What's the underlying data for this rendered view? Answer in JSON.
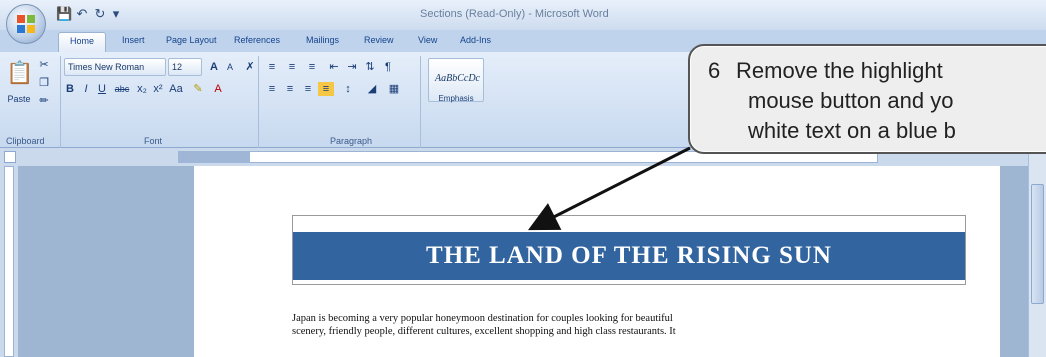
{
  "window": {
    "title": "Sections (Read-Only) - Microsoft Word"
  },
  "tabs": [
    "Home",
    "Insert",
    "Page Layout",
    "References",
    "Mailings",
    "Review",
    "View",
    "Add-Ins"
  ],
  "ribbon": {
    "clipboard": {
      "paste_label": "Paste",
      "group_label": "Clipboard"
    },
    "font": {
      "font_name": "Times New Roman",
      "font_size": "12",
      "group_label": "Font"
    },
    "paragraph": {
      "group_label": "Paragraph"
    },
    "styles": {
      "preview_text": "AaBbCcDc",
      "emphasis_label": "Emphasis"
    }
  },
  "document": {
    "banner_title": "THE LAND OF THE RISING SUN",
    "body_lines": [
      "Japan is becoming a very popular honeymoon destination for couples looking for beautiful",
      "scenery, friendly people, different cultures, excellent shopping and high class restaurants. It"
    ]
  },
  "callout": {
    "number": "6",
    "lines": [
      "Remove the highlight",
      "mouse button and yo",
      "white text on a blue b"
    ]
  },
  "colors": {
    "banner_bg": "#3264a0",
    "banner_text": "#ffffff",
    "callout_bg": "#eeeeee",
    "ribbon_bg": "#dbe7f6"
  }
}
